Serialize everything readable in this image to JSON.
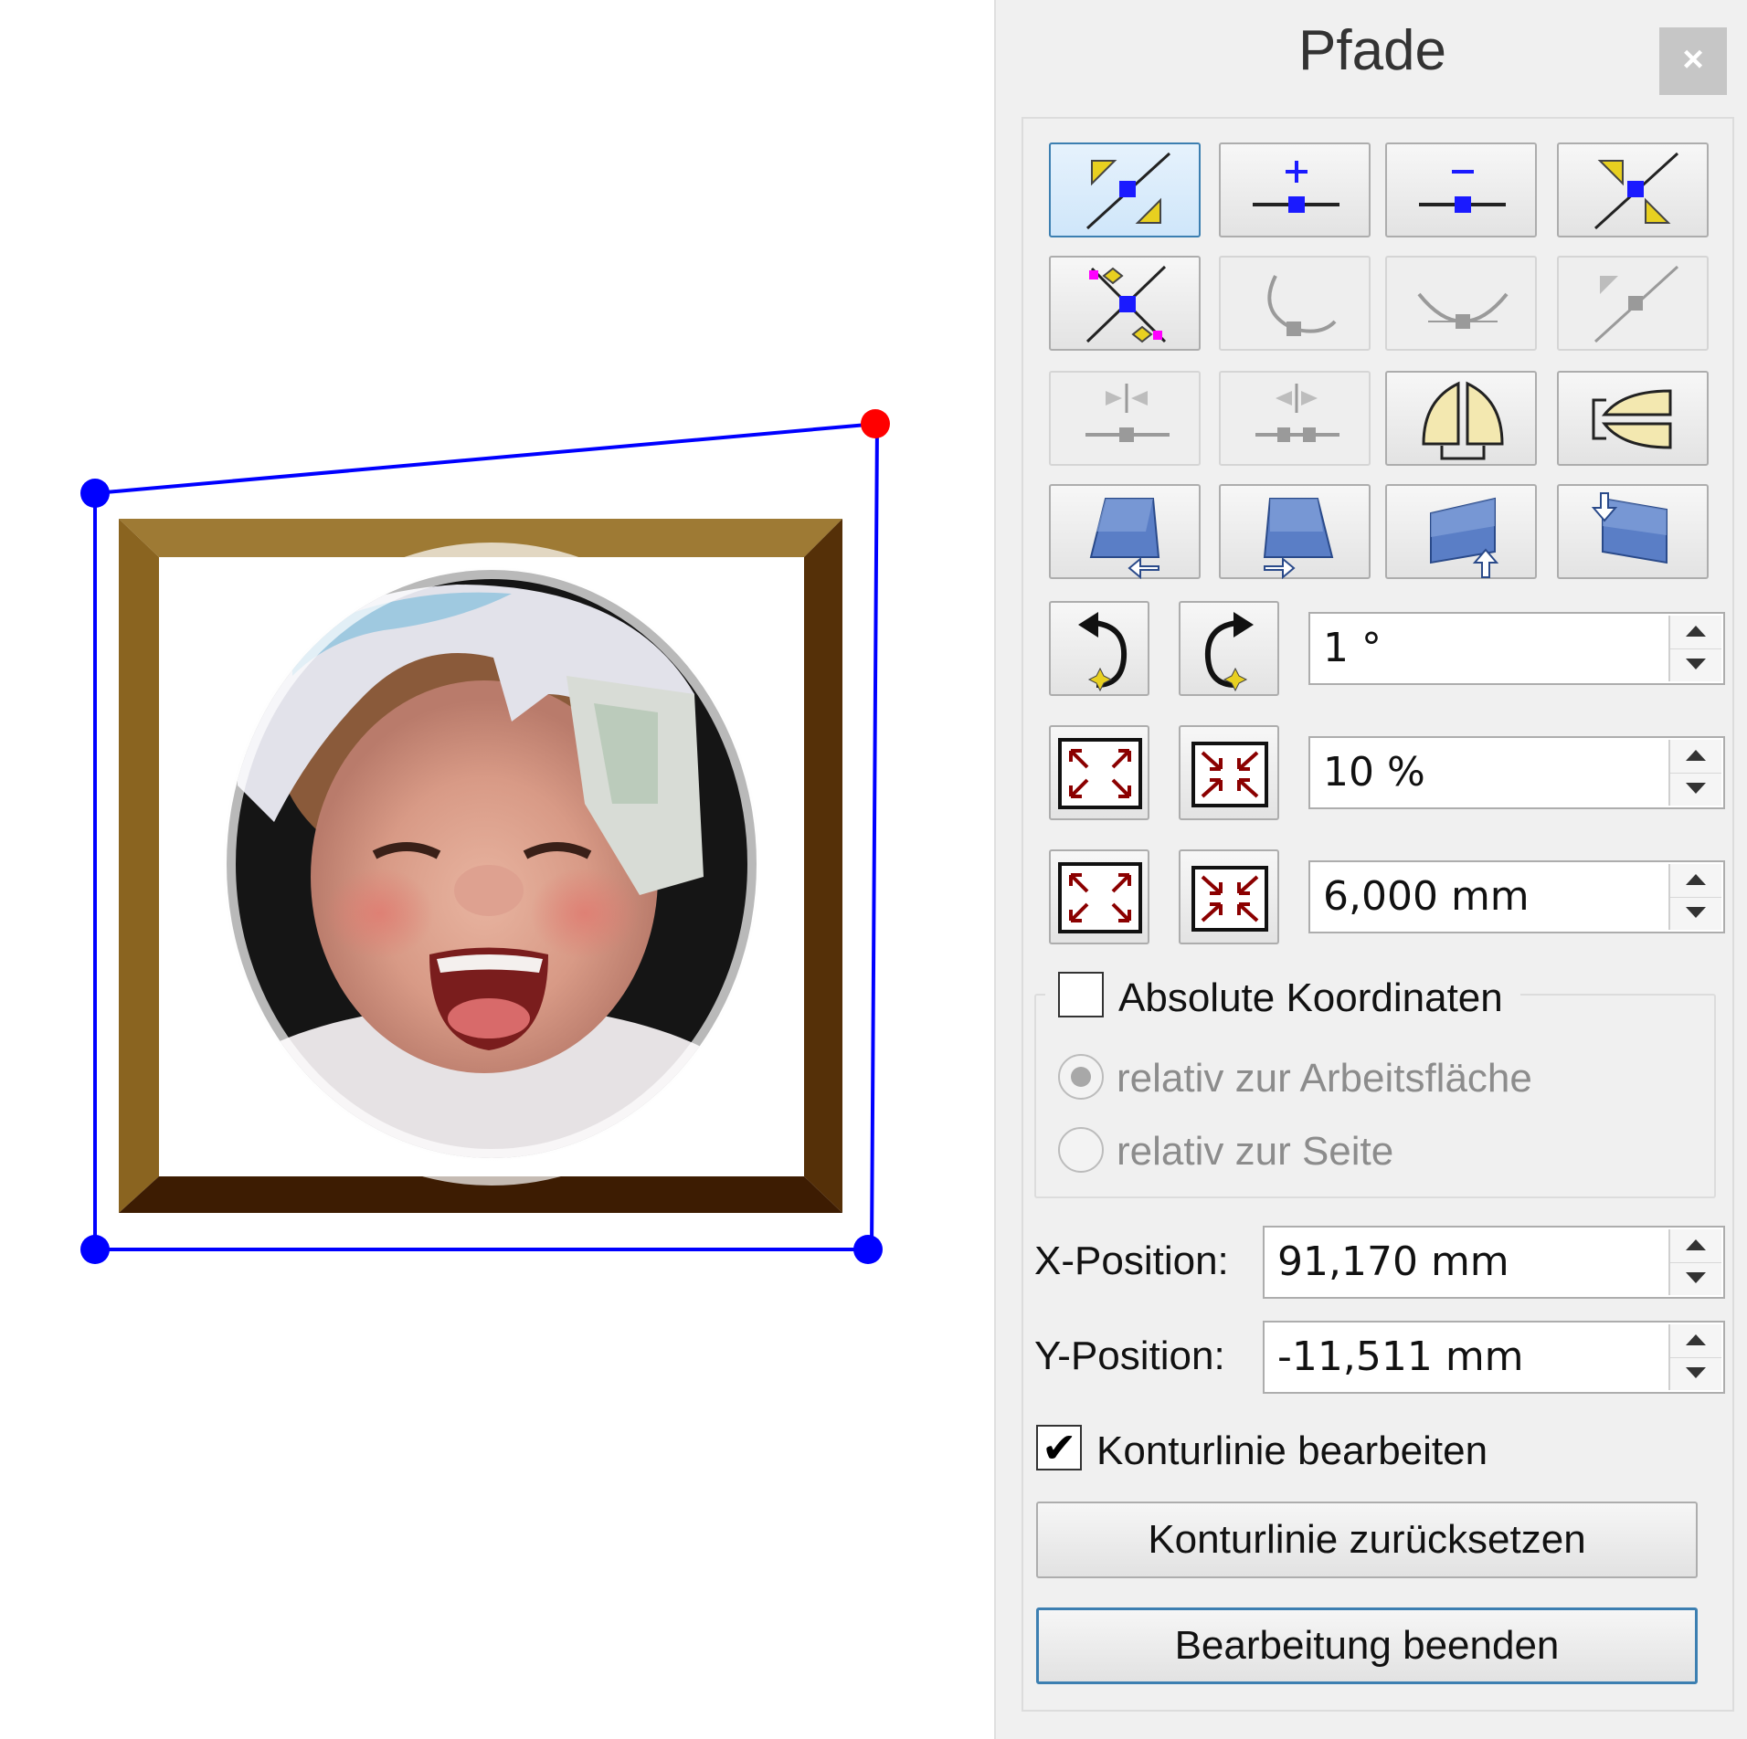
{
  "canvas": {
    "photo_description_name": "framed-photo"
  },
  "panel": {
    "title": "Pfade",
    "close_label": "×",
    "tools": {
      "row1": [
        "select-points",
        "add-point",
        "remove-point",
        "reset-control-points"
      ],
      "row2": [
        "move-control-points",
        "convert-to-curve",
        "convert-to-symmetric",
        "convert-to-corner"
      ],
      "row3": [
        "split-path",
        "join-path",
        "mirror-vertical",
        "mirror-horizontal"
      ],
      "row4": [
        "shear-left",
        "shear-right",
        "shear-up",
        "shear-down"
      ]
    },
    "rotate": {
      "value": "1 °"
    },
    "scale_percent": {
      "value": "10 %"
    },
    "scale_mm": {
      "value": "6,000 mm"
    },
    "absolute_coords": {
      "label": "Absolute Koordinaten",
      "checked": false,
      "option_workspace": "relativ zur Arbeitsfläche",
      "option_page": "relativ zur Seite"
    },
    "x_position": {
      "label": "X-Position:",
      "value": "91,170 mm"
    },
    "y_position": {
      "label": "Y-Position:",
      "value": "-11,511 mm"
    },
    "edit_contour": {
      "label": "Konturlinie bearbeiten",
      "checked": true
    },
    "reset_contour_label": "Konturlinie zurücksetzen",
    "finish_editing_label": "Bearbeitung beenden"
  },
  "colors": {
    "path_line": "#0000ff",
    "selected_node": "#ff0000",
    "frame_light": "#9c7a33",
    "frame_dark": "#4a2a05",
    "active_tool_border": "#3c7fb1"
  }
}
